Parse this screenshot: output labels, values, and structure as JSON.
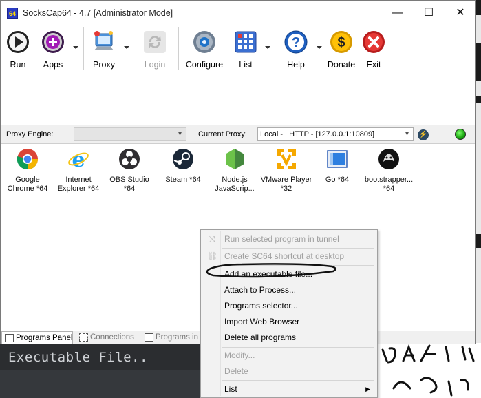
{
  "window": {
    "title": "SocksCap64 - 4.7 [Administrator Mode]",
    "app_icon_text": "64",
    "controls": {
      "minimize": "—",
      "maximize": "☐",
      "close": "✕"
    }
  },
  "toolbar": {
    "run": "Run",
    "apps": "Apps",
    "proxy": "Proxy",
    "login": "Login",
    "configure": "Configure",
    "list": "List",
    "help": "Help",
    "donate": "Donate",
    "exit": "Exit"
  },
  "proxy_bar": {
    "engine_label": "Proxy Engine:",
    "engine_value": "",
    "current_label": "Current Proxy:",
    "current_value": "Local -   HTTP - [127.0.0.1:10809]",
    "status_color": "#17a30e"
  },
  "programs": [
    {
      "name": "Google\nChrome *64",
      "icon": "chrome-icon"
    },
    {
      "name": "Internet\nExplorer *64",
      "icon": "internet-explorer-icon"
    },
    {
      "name": "OBS Studio\n*64",
      "icon": "obs-icon"
    },
    {
      "name": "Steam *64",
      "icon": "steam-icon"
    },
    {
      "name": "Node.js\nJavaScrip...",
      "icon": "nodejs-icon"
    },
    {
      "name": "VMware Player\n*32",
      "icon": "vmware-icon"
    },
    {
      "name": "Go *64",
      "icon": "go-icon"
    },
    {
      "name": "bootstrapper...\n*64",
      "icon": "bootstrapper-icon"
    }
  ],
  "tabs": {
    "programs_panel": "Programs Panel",
    "connections": "Connections",
    "programs_in_tunnel": "Programs in T"
  },
  "context_menu": {
    "run_in_tunnel": "Run selected program in tunnel",
    "create_shortcut": "Create SC64 shortcut at desktop",
    "add_executable": "Add an executable file...",
    "attach_process": "Attach to Process...",
    "programs_selector": "Programs selector...",
    "import_browser": "Import Web Browser",
    "delete_all": "Delete all programs",
    "modify": "Modify...",
    "delete": "Delete",
    "list": "List"
  },
  "terminal": {
    "text": "Executable File.."
  }
}
